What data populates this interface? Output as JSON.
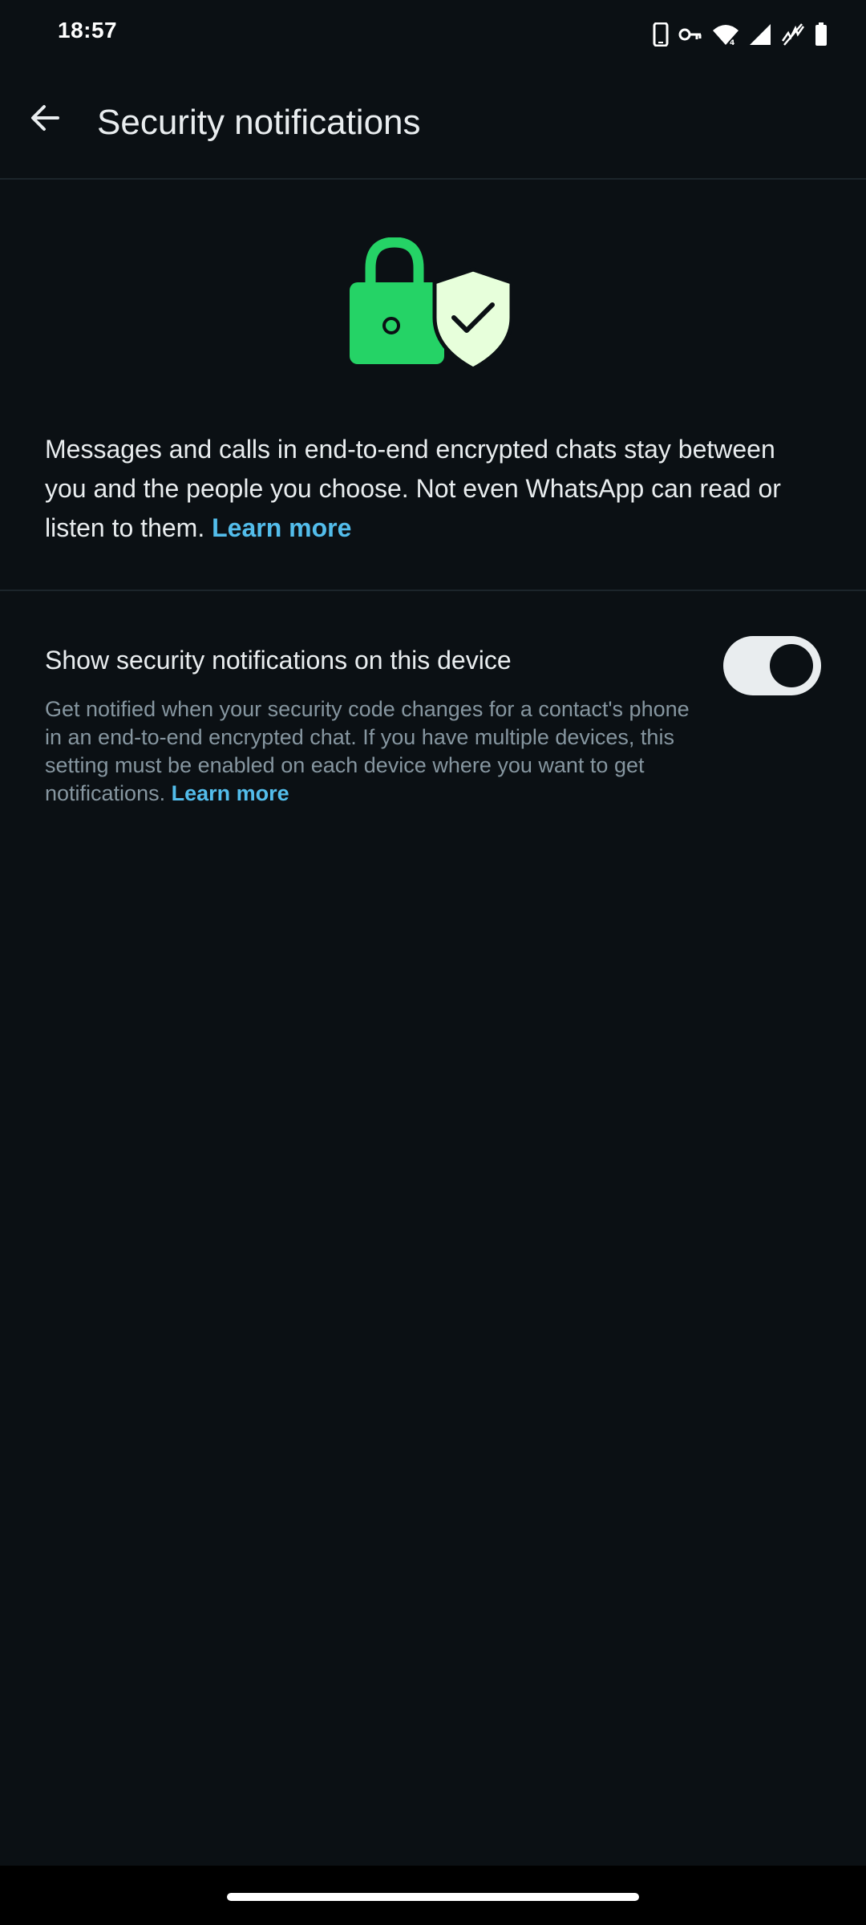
{
  "status_bar": {
    "time": "18:57",
    "icons": [
      "phone-icon",
      "vpn-key-icon",
      "wifi-icon",
      "signal-icon",
      "no-signal-icon",
      "battery-icon"
    ]
  },
  "app_bar": {
    "back_icon": "arrow-left-icon",
    "title": "Security notifications"
  },
  "hero": {
    "icons": [
      "lock-icon",
      "shield-check-icon"
    ],
    "colors": {
      "lock": "#25d366",
      "shield": "#e7ffdb",
      "outline": "#0b1014"
    }
  },
  "intro": {
    "text": "Messages and calls in end-to-end encrypted chats stay between you and the people you choose. Not even WhatsApp can read or listen to them.",
    "link": "Learn more"
  },
  "setting": {
    "title": "Show security notifications on this device",
    "description": "Get notified when your security code changes for a contact's phone in an end-to-end encrypted chat. If you have multiple devices, this setting must be enabled on each device where you want to get notifications.",
    "link": "Learn more",
    "enabled": true
  },
  "theme": {
    "background": "#0b1014",
    "text_primary": "#e9edef",
    "text_secondary": "#8696a0",
    "link": "#53bdeb",
    "divider": "#1c252b"
  }
}
